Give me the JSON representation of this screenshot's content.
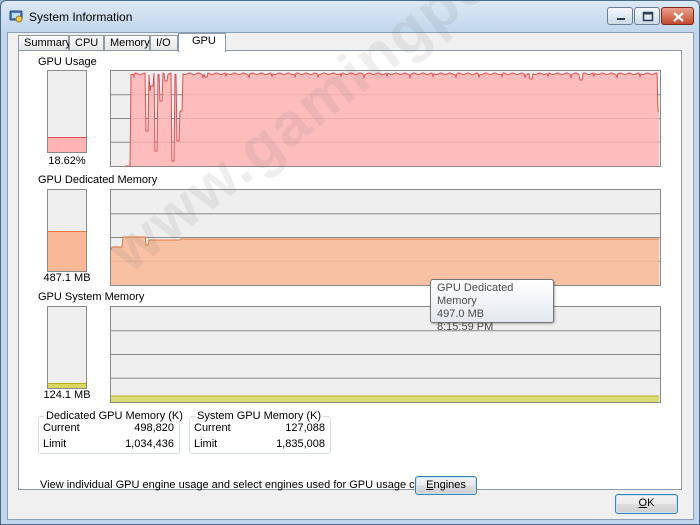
{
  "window": {
    "title": "System Information",
    "icons": {
      "app": "system-information-icon",
      "minimize": "minimize-icon",
      "maximize": "maximize-icon",
      "close": "close-icon"
    }
  },
  "tabs": [
    {
      "label": "Summary",
      "active": false
    },
    {
      "label": "CPU",
      "active": false
    },
    {
      "label": "Memory",
      "active": false
    },
    {
      "label": "I/O",
      "active": false
    },
    {
      "label": "GPU",
      "active": true
    }
  ],
  "gpu_usage": {
    "label": "GPU Usage",
    "value": "18.62%",
    "level": 0.1862,
    "fill_color": "#ffb4b4",
    "line_color": "#e05050"
  },
  "gpu_dedicated_memory": {
    "label": "GPU Dedicated Memory",
    "value": "487.1 MB",
    "level": 0.5,
    "fill_color": "#f9b896",
    "line_color": "#e5783f"
  },
  "gpu_system_memory": {
    "label": "GPU System Memory",
    "value": "124.1 MB",
    "level": 0.06,
    "fill_color": "#d8d860",
    "line_color": "#b0b020"
  },
  "tooltip": {
    "title": "GPU Dedicated Memory",
    "value": "497.0 MB",
    "time": "8:15:59 PM"
  },
  "dedicated_group": {
    "title": "Dedicated GPU Memory (K)",
    "current_label": "Current",
    "current_value": "498,820",
    "limit_label": "Limit",
    "limit_value": "1,034,436"
  },
  "system_group": {
    "title": "System GPU Memory (K)",
    "current_label": "Current",
    "current_value": "127,088",
    "limit_label": "Limit",
    "limit_value": "1,835,008"
  },
  "engines_text": "View individual GPU engine usage and select engines used for GPU usage calculations:",
  "engines_button": {
    "prefix": "",
    "accel": "E",
    "rest": "ngines"
  },
  "ok_button": {
    "prefix": "",
    "accel": "O",
    "rest": "K"
  },
  "watermark": "www.gamingpcbuilder.com"
}
